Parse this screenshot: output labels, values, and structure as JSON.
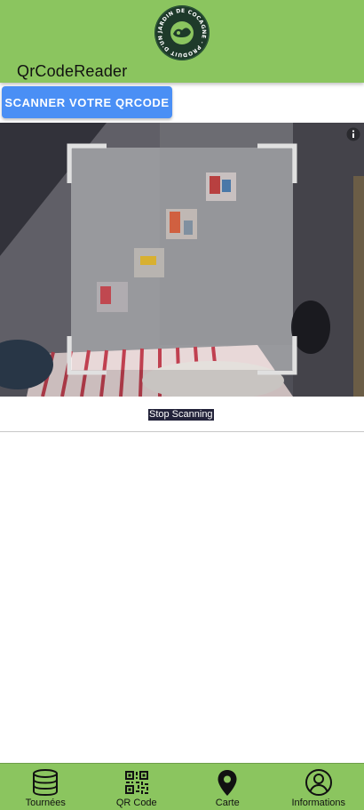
{
  "header": {
    "logo_text": "JARDIN DE COCAGNE · PRODUIT D'UN",
    "title": "QrCodeReader"
  },
  "scanner": {
    "scan_button_label": "SCANNER VOTRE QRCODE",
    "stop_button_label": "Stop Scanning",
    "info_icon": "info-icon"
  },
  "nav": {
    "items": [
      {
        "label": "Tournées",
        "icon": "database-icon"
      },
      {
        "label": "QR Code",
        "icon": "qr-code-icon"
      },
      {
        "label": "Carte",
        "icon": "map-pin-icon"
      },
      {
        "label": "Informations",
        "icon": "user-circle-icon"
      }
    ]
  },
  "colors": {
    "header_bg": "#8bc55f",
    "button_bg": "#4a8ff5",
    "logo_bg": "#1e3a2a"
  }
}
